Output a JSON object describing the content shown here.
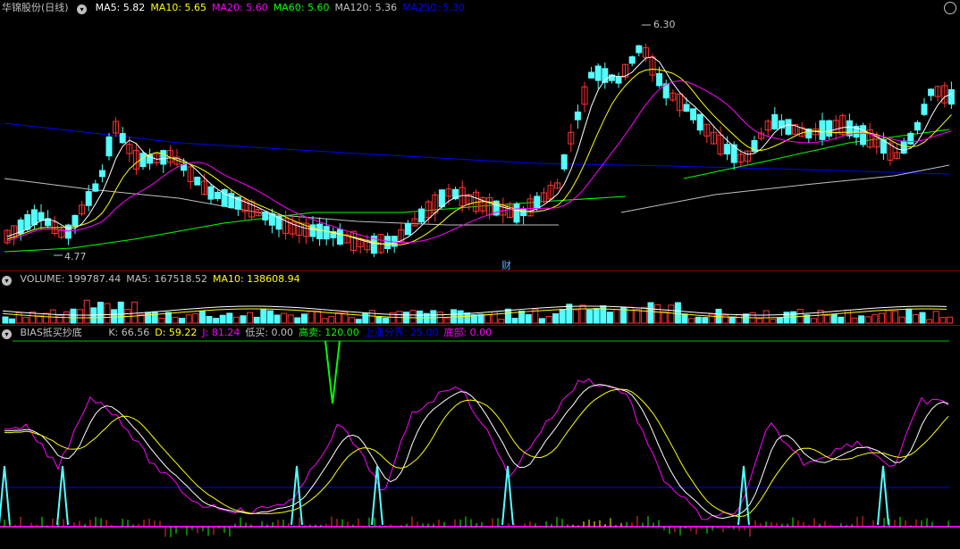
{
  "price": {
    "title": "华锦股份(日线)",
    "indicators": [
      {
        "label": "MA5: 5.82",
        "color": "#ffffff"
      },
      {
        "label": "MA10: 5.65",
        "color": "#ffff00"
      },
      {
        "label": "MA20: 5.60",
        "color": "#ff00ff"
      },
      {
        "label": "MA60: 5.60",
        "color": "#00ff00"
      },
      {
        "label": "MA120: 5.36",
        "color": "#c0c0c0"
      },
      {
        "label": "MA250: 5.30",
        "color": "#0000ff"
      }
    ],
    "high_label": "6.30",
    "low_label": "4.77",
    "fin_badge": "财"
  },
  "volume": {
    "indicators": [
      {
        "label": "VOLUME: 199787.44",
        "color": "#c0c0c0"
      },
      {
        "label": "MA5: 167518.52",
        "color": "#c0c0c0"
      },
      {
        "label": "MA10: 138608.94",
        "color": "#ffff00"
      }
    ]
  },
  "bias": {
    "title": "BIAS抵买抄底",
    "indicators": [
      {
        "label": "K: 66.56",
        "color": "#c0c0c0"
      },
      {
        "label": "D: 59.22",
        "color": "#ffff00"
      },
      {
        "label": "J: 81.24",
        "color": "#ff00ff"
      },
      {
        "label": "低买: 0.00",
        "color": "#c0c0c0"
      },
      {
        "label": "高卖: 120.00",
        "color": "#00ff00"
      },
      {
        "label": "上涨分界: 25.00",
        "color": "#0000ff"
      },
      {
        "label": "底部: 0.00",
        "color": "#ff00ff"
      }
    ]
  },
  "colors": {
    "up": "#ff3232",
    "down": "#54ffff",
    "ma5": "#ffffff",
    "ma10": "#ffff00",
    "ma20": "#ff00ff",
    "ma60": "#00ff00",
    "ma120": "#c0c0c0",
    "ma250": "#0000ff"
  },
  "icons": {
    "settings": "gear-icon",
    "collapse": "chevron-down-icon"
  }
}
